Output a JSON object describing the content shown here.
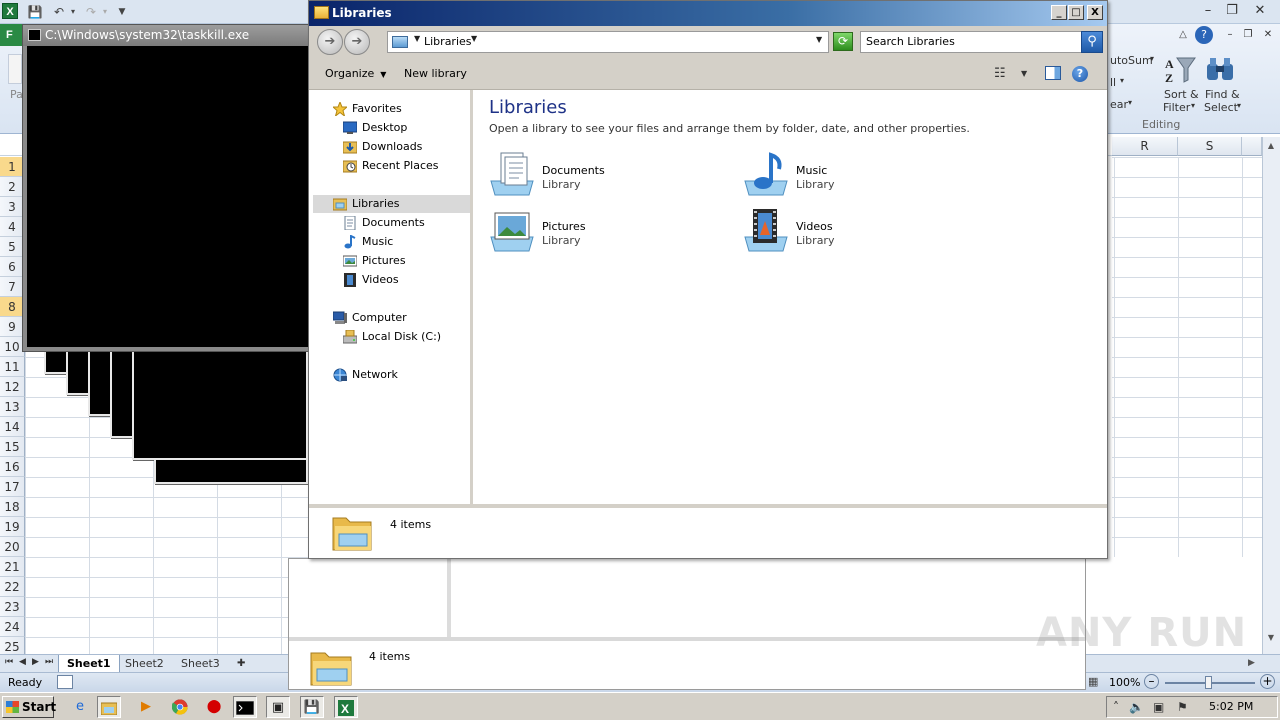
{
  "excel": {
    "file_tab": "F",
    "columns": [
      {
        "label": "R"
      },
      {
        "label": "S"
      }
    ],
    "rows": [
      "1",
      "2",
      "3",
      "4",
      "5",
      "6",
      "7",
      "8",
      "9",
      "10",
      "11",
      "12",
      "13",
      "14",
      "15",
      "16",
      "17",
      "18",
      "19",
      "20",
      "21",
      "22",
      "23",
      "24",
      "25"
    ],
    "selected_rows": [
      "1",
      "8"
    ],
    "ribbon": {
      "paste_fragment": "Pa",
      "autosum_fragment": "utoSum",
      "fill_fragment": "ll",
      "clear_fragment": "ear",
      "sort_filter_line1": "Sort &",
      "sort_filter_line2": "Filter",
      "find_select_line1": "Find &",
      "find_select_line2": "Select",
      "group_label": "Editing"
    },
    "sheets": [
      "Sheet1",
      "Sheet2",
      "Sheet3"
    ],
    "active_sheet": "Sheet1",
    "status_text": "Ready",
    "zoom": "100%"
  },
  "cmd_window": {
    "title": "C:\\Windows\\system32\\taskkill.exe"
  },
  "ghost_explorer": {
    "status_text": "4 items"
  },
  "explorer": {
    "title": "Libraries",
    "window_buttons": {
      "minimize": "_",
      "maximize": "□",
      "close": "X"
    },
    "address": "Libraries",
    "search_placeholder": "Search Libraries",
    "toolbar": {
      "organize": "Organize",
      "new_library": "New library"
    },
    "nav": {
      "favorites": "Favorites",
      "desktop": "Desktop",
      "downloads": "Downloads",
      "recent_places": "Recent Places",
      "libraries": "Libraries",
      "documents": "Documents",
      "music": "Music",
      "pictures": "Pictures",
      "videos": "Videos",
      "computer": "Computer",
      "local_disk": "Local Disk (C:)",
      "network": "Network"
    },
    "content": {
      "heading": "Libraries",
      "subtitle": "Open a library to see your files and arrange them by folder, date, and other properties.",
      "items": [
        {
          "name": "Documents",
          "type": "Library",
          "icon": "documents-library-icon"
        },
        {
          "name": "Music",
          "type": "Library",
          "icon": "music-library-icon"
        },
        {
          "name": "Pictures",
          "type": "Library",
          "icon": "pictures-library-icon"
        },
        {
          "name": "Videos",
          "type": "Library",
          "icon": "videos-library-icon"
        }
      ]
    },
    "status_text": "4 items"
  },
  "taskbar": {
    "start_label": "Start",
    "clock": "5:02 PM"
  },
  "watermark": "ANY RUN"
}
